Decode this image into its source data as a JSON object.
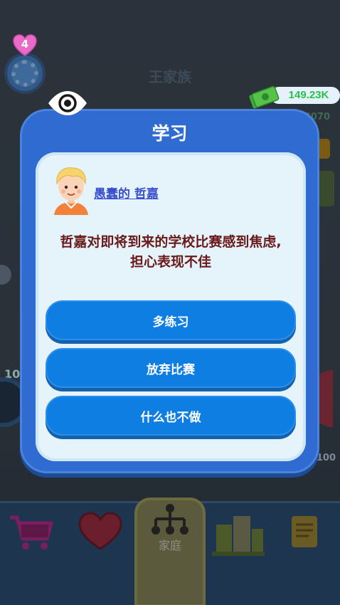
{
  "background": {
    "title": "王家族",
    "heart_count": "4",
    "money": "149.23K",
    "left_badge": "10",
    "right_value_top": "2070",
    "right_value_bottom": "100"
  },
  "dialog": {
    "title": "学习",
    "character_name": "愚蠢的 哲嘉",
    "event_text_line1": "哲嘉对即将到来的学校比赛感到焦虑,",
    "event_text_line2": "担心表现不佳",
    "choices": [
      {
        "label": "多练习"
      },
      {
        "label": "放弃比赛"
      },
      {
        "label": "什么也不做"
      }
    ]
  },
  "bottom_nav": {
    "items": [
      {
        "icon": "cart-icon"
      },
      {
        "icon": "heart-icon"
      },
      {
        "icon": "family-tree-icon",
        "label": "家庭"
      },
      {
        "icon": "city-icon"
      },
      {
        "icon": "scroll-icon"
      }
    ]
  },
  "colors": {
    "dialog_blue": "#2f6bd0",
    "button_blue": "#0e7ee3",
    "event_text": "#6a1a1a",
    "name_link": "#3a4fcc",
    "money_green": "#28c24a"
  }
}
